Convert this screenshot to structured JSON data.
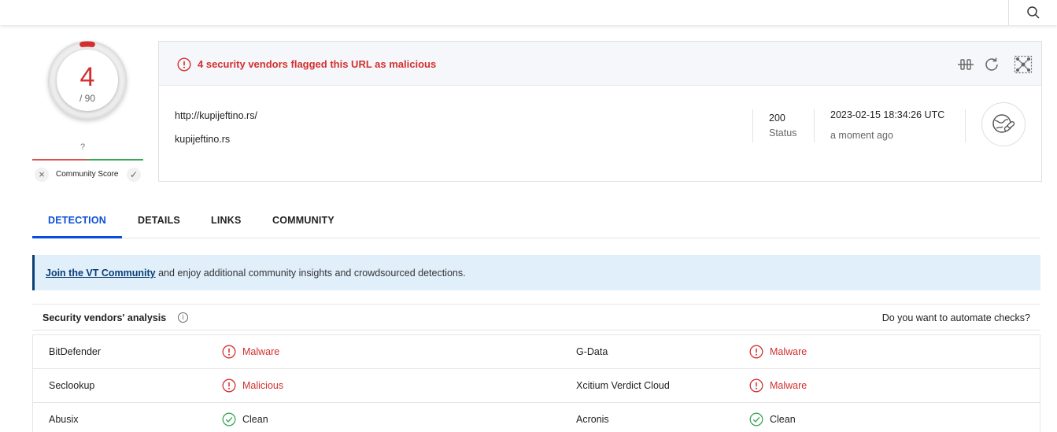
{
  "colors": {
    "malicious": "#d32f2f",
    "clean": "#3aa757",
    "accent": "#0b4dda"
  },
  "header": {
    "search_icon": "search-icon"
  },
  "score": {
    "detections": "4",
    "total": "/ 90",
    "community_unknown": "?",
    "community_label": "Community Score",
    "dislike": "×",
    "like": "✓",
    "detection_ratio": 0.0444
  },
  "summary": {
    "alert": "4 security vendors flagged this URL as malicious",
    "url": "http://kupijeftino.rs/",
    "domain": "kupijeftino.rs",
    "status_code": "200",
    "status_label": "Status",
    "date": "2023-02-15 18:34:26 UTC",
    "ago": "a moment ago",
    "icons": [
      "compare-icon",
      "reanalyze-icon",
      "graph-icon",
      "url-globe-icon"
    ]
  },
  "tabs": [
    {
      "label": "DETECTION",
      "active": true
    },
    {
      "label": "DETAILS",
      "active": false
    },
    {
      "label": "LINKS",
      "active": false
    },
    {
      "label": "COMMUNITY",
      "active": false
    }
  ],
  "banner": {
    "link": "Join the VT Community",
    "text": " and enjoy additional community insights and crowdsourced detections."
  },
  "analysis": {
    "title": "Security vendors' analysis",
    "automate": "Do you want to automate checks?",
    "rows": [
      {
        "left_vendor": "BitDefender",
        "left_result": "Malware",
        "left_status": "malicious",
        "right_vendor": "G-Data",
        "right_result": "Malware",
        "right_status": "malicious"
      },
      {
        "left_vendor": "Seclookup",
        "left_result": "Malicious",
        "left_status": "malicious",
        "right_vendor": "Xcitium Verdict Cloud",
        "right_result": "Malware",
        "right_status": "malicious"
      },
      {
        "left_vendor": "Abusix",
        "left_result": "Clean",
        "left_status": "clean",
        "right_vendor": "Acronis",
        "right_result": "Clean",
        "right_status": "clean"
      }
    ]
  }
}
